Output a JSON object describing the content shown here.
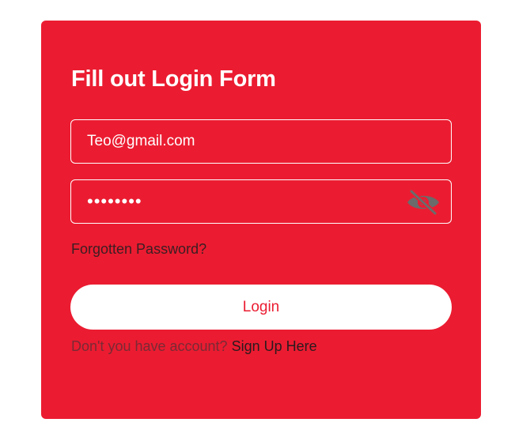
{
  "form": {
    "title": "Fill out Login Form",
    "email_value": "Teo@gmail.com",
    "password_value": "••••••••",
    "password_visibility_icon": "eye-slash-icon",
    "forgot_password_label": "Forgotten Password?",
    "login_label": "Login",
    "signup_prompt": "Don't you have account?",
    "signup_link": "Sign Up Here"
  },
  "colors": {
    "card_background": "#eb1c31",
    "button_background": "#ffffff",
    "button_text": "#eb1c31",
    "icon_color": "#6b6b6b"
  }
}
